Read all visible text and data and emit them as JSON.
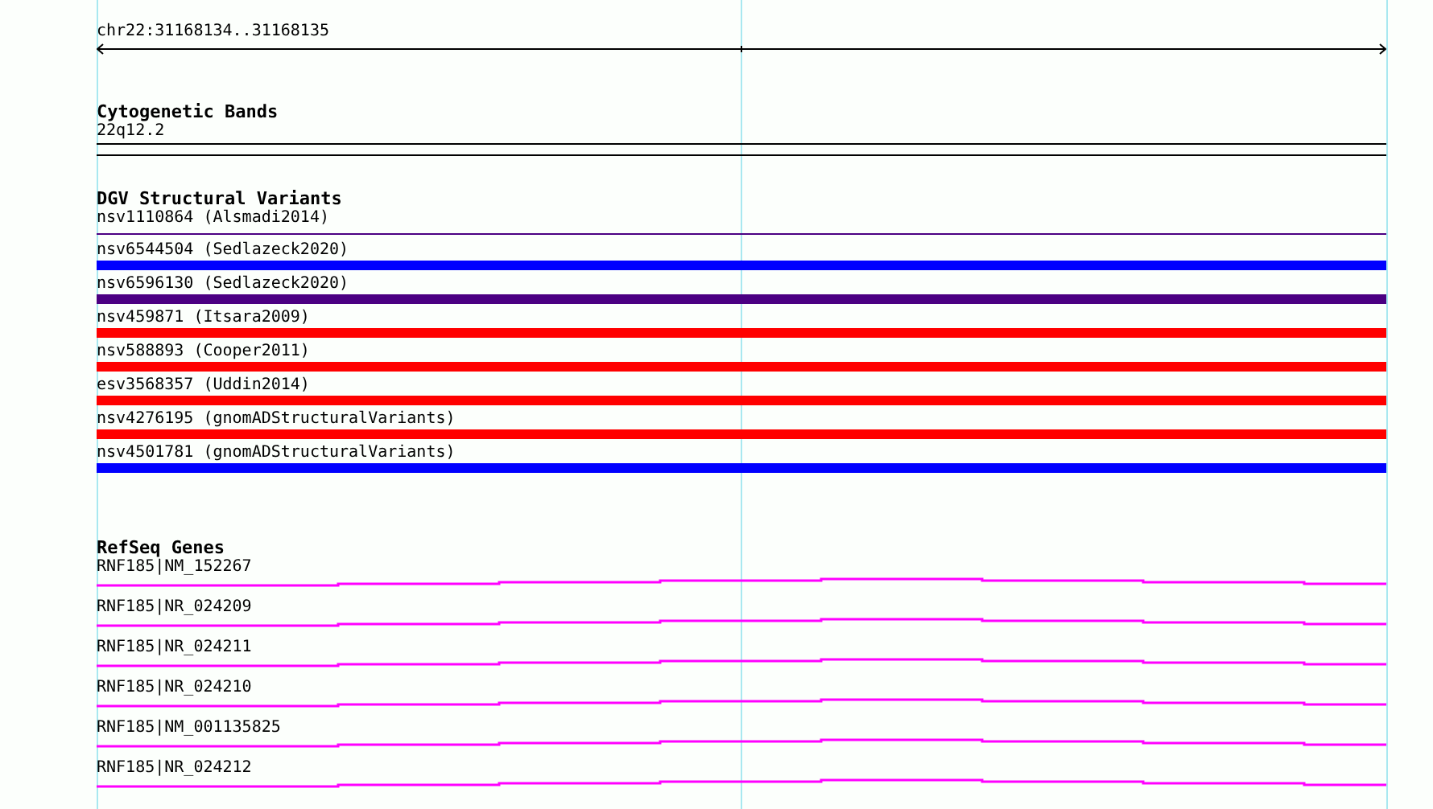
{
  "ruler": {
    "location": "chr22:31168134..31168135"
  },
  "cytoband_track": {
    "title": "Cytogenetic Bands",
    "band": "22q12.2"
  },
  "variant_track": {
    "title": "DGV Structural Variants",
    "features": [
      {
        "label": "nsv1110864 (Alsmadi2014)",
        "kind": "line",
        "color": "#4b0082"
      },
      {
        "label": "nsv6544504 (Sedlazeck2020)",
        "kind": "bar",
        "color": "#0000ff"
      },
      {
        "label": "nsv6596130 (Sedlazeck2020)",
        "kind": "bar",
        "color": "#4b0082"
      },
      {
        "label": "nsv459871 (Itsara2009)",
        "kind": "bar",
        "color": "#ff0000"
      },
      {
        "label": "nsv588893 (Cooper2011)",
        "kind": "bar",
        "color": "#ff0000"
      },
      {
        "label": "esv3568357 (Uddin2014)",
        "kind": "bar",
        "color": "#ff0000"
      },
      {
        "label": "nsv4276195 (gnomADStructuralVariants)",
        "kind": "bar",
        "color": "#ff0000"
      },
      {
        "label": "nsv4501781 (gnomADStructuralVariants)",
        "kind": "bar",
        "color": "#0000ff"
      }
    ]
  },
  "gene_track": {
    "title": "RefSeq Genes",
    "features": [
      {
        "label": "RNF185|NM_152267"
      },
      {
        "label": "RNF185|NR_024209"
      },
      {
        "label": "RNF185|NR_024211"
      },
      {
        "label": "RNF185|NR_024210"
      },
      {
        "label": "RNF185|NM_001135825"
      },
      {
        "label": "RNF185|NR_024212"
      }
    ]
  }
}
